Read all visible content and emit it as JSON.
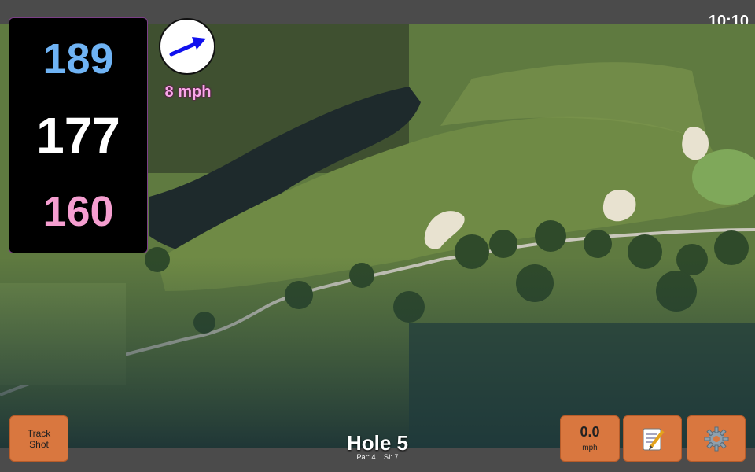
{
  "status": {
    "time": "10:10"
  },
  "distances": {
    "back": "189",
    "middle": "177",
    "front": "160"
  },
  "wind": {
    "speed_label": "8 mph",
    "arrow_icon": "arrow-right-icon"
  },
  "hole": {
    "title": "Hole 5",
    "par_label": "Par: 4",
    "si_label": "SI: 7"
  },
  "buttons": {
    "track_shot_line1": "Track",
    "track_shot_line2": "Shot",
    "wind_value": "0.0",
    "wind_unit": "mph",
    "notes_icon": "notepad-icon",
    "settings_icon": "gear-icon"
  },
  "colors": {
    "back_distance": "#6fb3f4",
    "middle_distance": "#ffffff",
    "front_distance": "#f59ed0",
    "button": "#d9773f"
  }
}
